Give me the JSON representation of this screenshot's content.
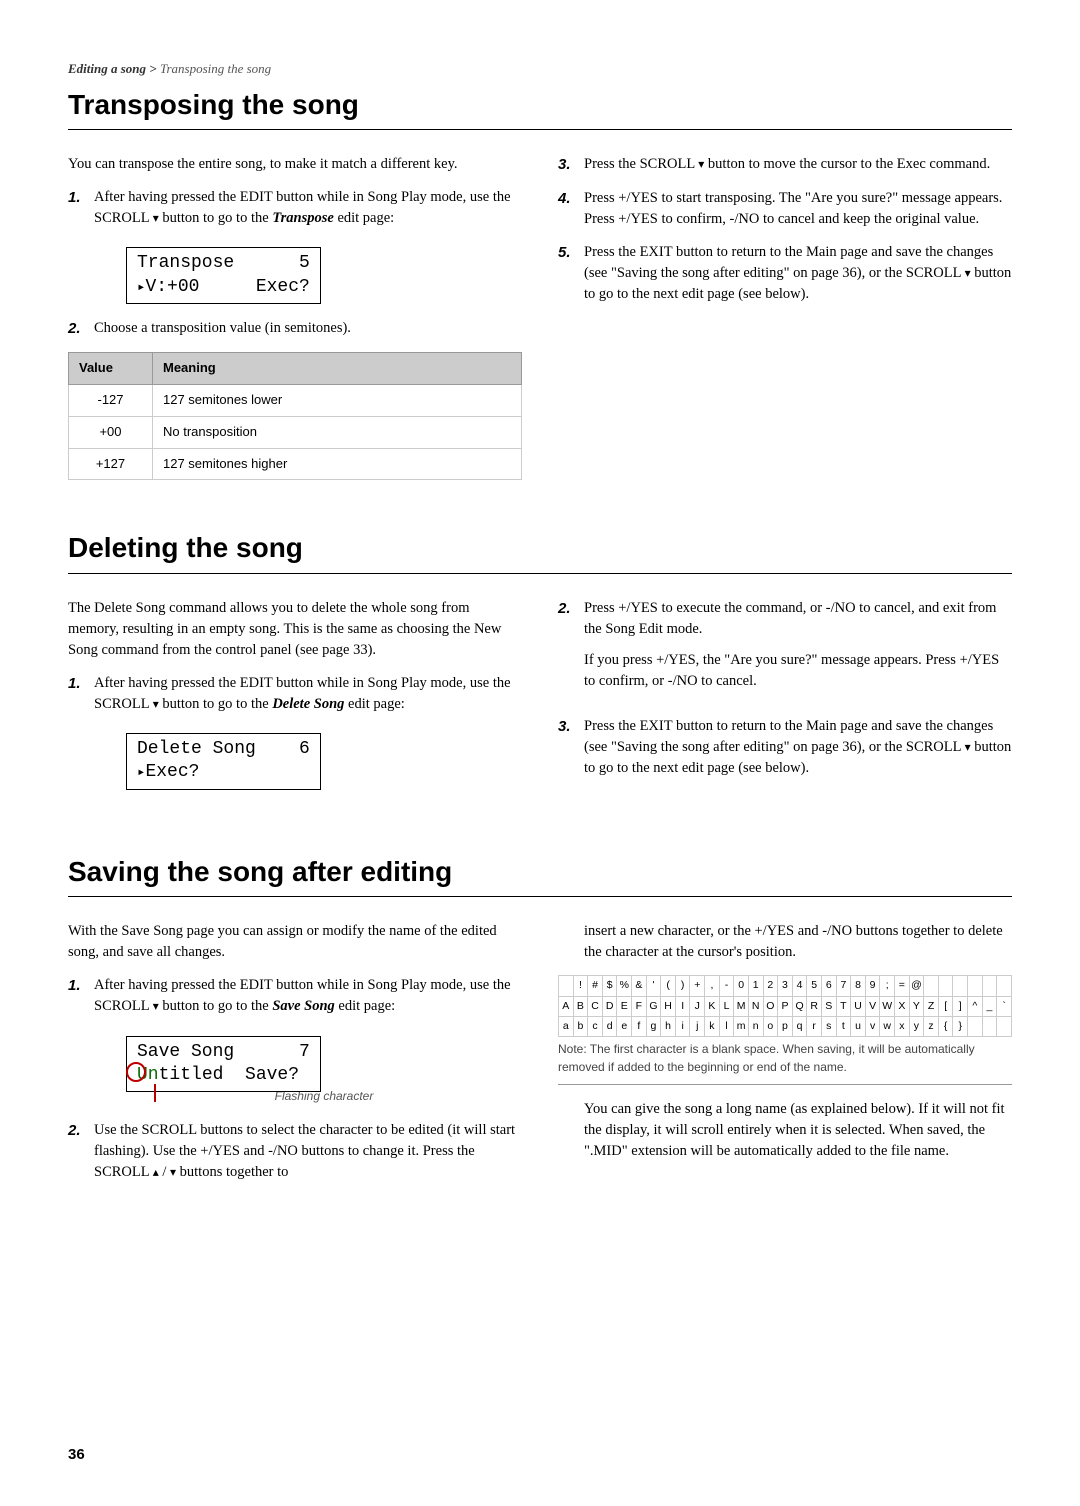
{
  "breadcrumb": {
    "bold": "Editing a song >",
    "rest": " Transposing the song"
  },
  "sec1": {
    "title": "Transposing the song",
    "intro": "You can transpose the entire song, to make it match a different key.",
    "step1": {
      "num": "1.",
      "textA": "After having pressed the EDIT button while in Song Play mode, use the SCROLL ",
      "textB": " button to go to the ",
      "kw": "Transpose",
      "textC": " edit page:"
    },
    "lcd": {
      "line1a": "Transpose",
      "line1b": "5",
      "line2a": "V:+00",
      "line2b": "Exec?"
    },
    "step2": {
      "num": "2.",
      "text": "Choose a transposition value (in semitones)."
    },
    "table": {
      "h1": "Value",
      "h2": "Meaning",
      "rows": [
        {
          "v": "-127",
          "m": "127 semitones lower"
        },
        {
          "v": "+00",
          "m": "No transposition"
        },
        {
          "v": "+127",
          "m": "127 semitones higher"
        }
      ]
    },
    "step3": {
      "num": "3.",
      "textA": "Press the SCROLL ",
      "textB": " button to move the cursor to the Exec command."
    },
    "step4": {
      "num": "4.",
      "text": "Press +/YES to start transposing. The \"Are you sure?\" message appears. Press +/YES to confirm, -/NO to cancel and keep the original value."
    },
    "step5": {
      "num": "5.",
      "textA": "Press the EXIT button to return to the Main page and save the changes (see \"Saving the song after editing\" on page 36), or the SCROLL ",
      "textB": " button to go to the next edit page (see below)."
    }
  },
  "sec2": {
    "title": "Deleting the song",
    "intro": "The Delete Song command allows you to delete the whole song from memory, resulting in an empty song. This is the same as choosing the New Song command from the control panel (see page 33).",
    "step1": {
      "num": "1.",
      "textA": "After having pressed the EDIT button while in Song Play mode, use the SCROLL ",
      "textB": " button to go to the ",
      "kw": "Delete Song",
      "textC": " edit page:"
    },
    "lcd": {
      "line1a": "Delete Song",
      "line1b": "6",
      "line2a": "Exec?"
    },
    "step2": {
      "num": "2.",
      "text": "Press +/YES to execute the command, or -/NO to cancel, and exit from the Song Edit mode."
    },
    "step2b": "If you press +/YES, the \"Are you sure?\" message appears. Press +/YES to confirm, or -/NO to cancel.",
    "step3": {
      "num": "3.",
      "textA": "Press the EXIT button to return to the Main page and save the changes (see \"Saving the song after editing\" on page 36), or the SCROLL ",
      "textB": " button to go to the next edit page (see below)."
    }
  },
  "sec3": {
    "title": "Saving the song after editing",
    "intro": "With the Save Song page you can assign or modify the name of the edited song, and save all changes.",
    "step1": {
      "num": "1.",
      "textA": "After having pressed the EDIT button while in Song Play mode, use the SCROLL ",
      "textB": " button to go to the ",
      "kw": "Save Song",
      "textC": " edit page:"
    },
    "lcd": {
      "line1a": "Save Song",
      "line1b": "7",
      "line2a": "Un",
      "line2b": "titled",
      "line2c": "Save?"
    },
    "caption": "Flashing character",
    "step2": {
      "num": "2.",
      "textA": "Use the SCROLL buttons to select the character to be edited (it will start flashing). Use the +/YES and -/NO buttons to change it. Press the SCROLL ",
      "slash": " / ",
      "textB": " buttons together to "
    },
    "right_top": "insert a new character, or the +/YES and -/NO buttons together to delete the character at the cursor's position.",
    "chars": {
      "r1": [
        " ",
        "!",
        "#",
        "$",
        "%",
        "&",
        "'",
        "(",
        ")",
        "+",
        ",",
        "-",
        "0",
        "1",
        "2",
        "3",
        "4",
        "5",
        "6",
        "7",
        "8",
        "9",
        ";",
        "=",
        "@",
        " ",
        " ",
        " ",
        " ",
        " ",
        " "
      ],
      "r2": [
        "A",
        "B",
        "C",
        "D",
        "E",
        "F",
        "G",
        "H",
        "I",
        "J",
        "K",
        "L",
        "M",
        "N",
        "O",
        "P",
        "Q",
        "R",
        "S",
        "T",
        "U",
        "V",
        "W",
        "X",
        "Y",
        "Z",
        "[",
        "]",
        "^",
        "_",
        "`"
      ],
      "r3": [
        "a",
        "b",
        "c",
        "d",
        "e",
        "f",
        "g",
        "h",
        "i",
        "j",
        "k",
        "l",
        "m",
        "n",
        "o",
        "p",
        "q",
        "r",
        "s",
        "t",
        "u",
        "v",
        "w",
        "x",
        "y",
        "z",
        "{",
        "}",
        " ",
        " ",
        " "
      ]
    },
    "note": "Note: The first character is a blank space. When saving, it will be automatically removed if added to the beginning or end of the name.",
    "para": "You can give the song a long name (as explained below). If it will not fit the display, it will scroll entirely when it is selected. When saved, the \".MID\" extension will be automatically added to the file name."
  },
  "page": "36"
}
